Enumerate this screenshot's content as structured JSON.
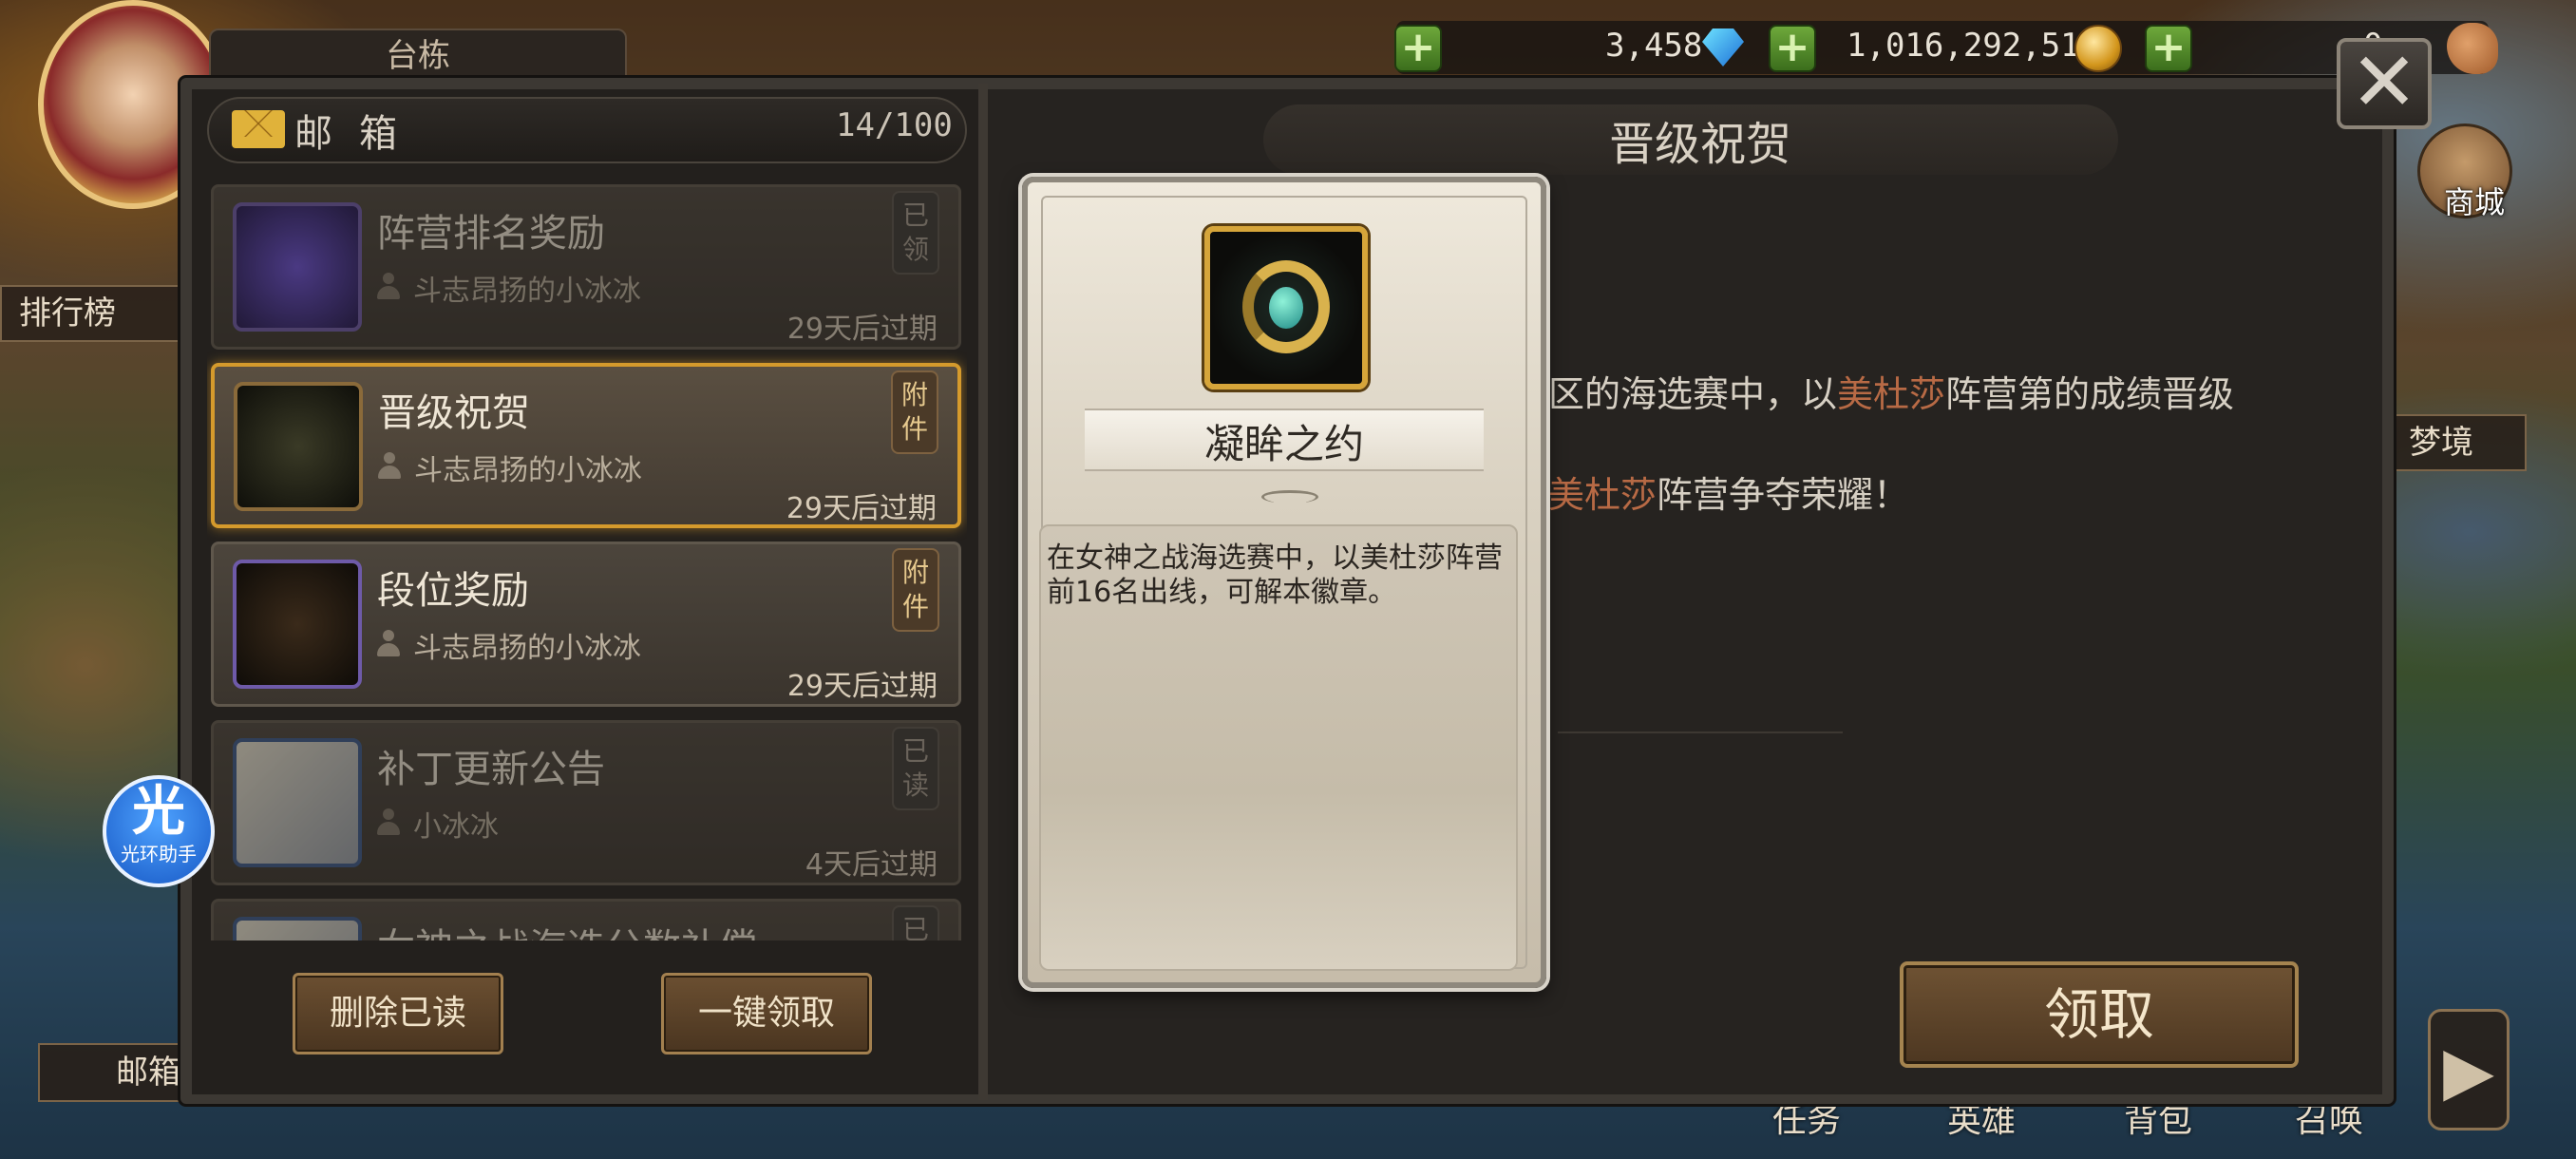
{
  "hud": {
    "top_tab": "台栋",
    "gems": "3,458",
    "gold": "1,016,292,511",
    "food": "0",
    "left_rank_button": "排行榜",
    "left_mail_button": "邮箱",
    "shop_label": "商城",
    "right_tab_label": "梦境",
    "helper_big": "光",
    "helper_small": "光环助手",
    "bottom_nav": [
      "任务",
      "英雄",
      "背包",
      "召唤"
    ]
  },
  "mailbox": {
    "title": "邮箱",
    "count": "14/100",
    "items": [
      {
        "title": "阵营排名奖励",
        "sender": "斗志昂扬的小冰冰",
        "expire": "29天后过期",
        "tag": "已领",
        "state": "read"
      },
      {
        "title": "晋级祝贺",
        "sender": "斗志昂扬的小冰冰",
        "expire": "29天后过期",
        "tag": "附件",
        "state": "selected"
      },
      {
        "title": "段位奖励",
        "sender": "斗志昂扬的小冰冰",
        "expire": "29天后过期",
        "tag": "附件",
        "state": "normal"
      },
      {
        "title": "补丁更新公告",
        "sender": "小冰冰",
        "expire": "4天后过期",
        "tag": "已读",
        "state": "read"
      },
      {
        "title": "女神之战海选分数补偿",
        "sender": "",
        "expire": "",
        "tag": "已读",
        "state": "read"
      }
    ],
    "delete_read": "删除已读",
    "claim_all": "一键领取"
  },
  "detail": {
    "subject": "晋级祝贺",
    "line1_pre": "区的海选赛中，以",
    "line1_hl": "美杜莎",
    "line1_mid": "阵营第",
    "line1_post": "的成绩晋级",
    "line2_hl": "美杜莎",
    "line2_post": "阵营争夺荣耀！",
    "claim": "领取"
  },
  "tooltip": {
    "item_name": "凝眸之约",
    "description": "在女神之战海选赛中，以美杜莎阵营前16名出线，可解本徽章。"
  }
}
